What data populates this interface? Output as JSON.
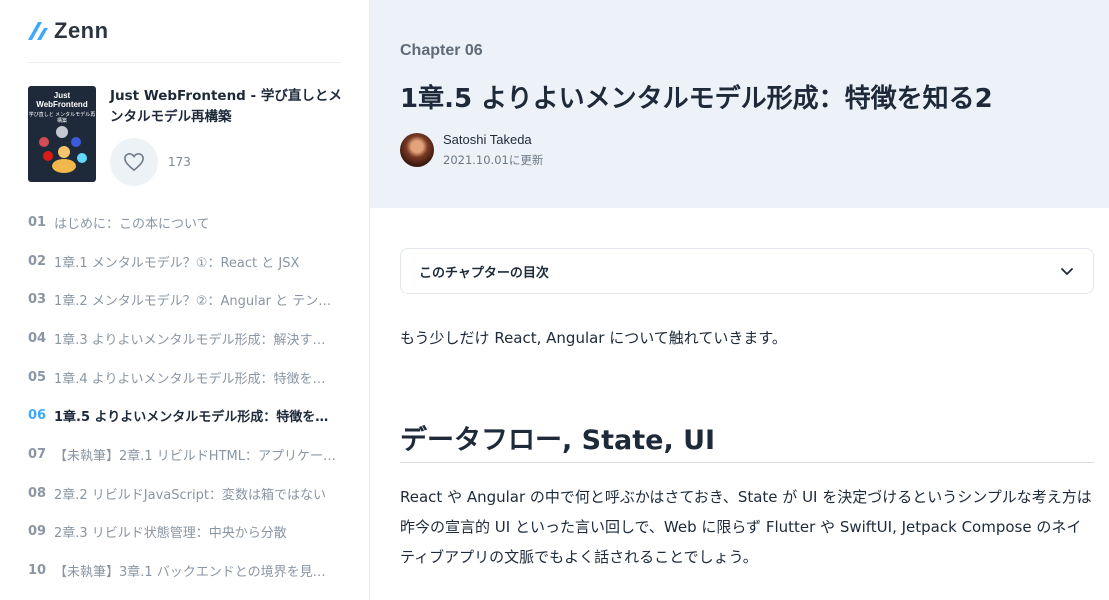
{
  "app": {
    "logo_text": "Zenn"
  },
  "book": {
    "cover_title": "Just WebFrontend",
    "cover_subtitle": "学び直しと メンタルモデル再構築",
    "title": "Just WebFrontend - 学び直しとメンタルモデル再構築",
    "like_count": "173"
  },
  "chapters": [
    {
      "num": "01",
      "label": "はじめに：この本について"
    },
    {
      "num": "02",
      "label": "1章.1 メンタルモデル？①：React と JSX"
    },
    {
      "num": "03",
      "label": "1章.2 メンタルモデル？②：Angular と テン…"
    },
    {
      "num": "04",
      "label": "1章.3 よりよいメンタルモデル形成：解決す…"
    },
    {
      "num": "05",
      "label": "1章.4 よりよいメンタルモデル形成：特徴を…"
    },
    {
      "num": "06",
      "label": "1章.5 よりよいメンタルモデル形成：特徴を…"
    },
    {
      "num": "07",
      "label": "【未執筆】2章.1 リビルドHTML：アプリケー…"
    },
    {
      "num": "08",
      "label": "2章.2 リビルドJavaScript：変数は箱ではない"
    },
    {
      "num": "09",
      "label": "2章.3 リビルド状態管理：中央から分散"
    },
    {
      "num": "10",
      "label": "【未執筆】3章.1 バックエンドとの境界を見…"
    }
  ],
  "header": {
    "chapter_tag": "Chapter 06",
    "title": "1章.5 よりよいメンタルモデル形成：特徴を知る2",
    "author": "Satoshi Takeda",
    "updated": "2021.10.01に更新"
  },
  "toc": {
    "label": "このチャプターの目次"
  },
  "content": {
    "intro": "もう少しだけ React, Angular について触れていきます。",
    "section_heading": "データフロー, State, UI",
    "paragraph": "React や Angular の中で何と呼ぶかはさておき、State が UI を決定づけるというシンプルな考え方は昨今の宣言的 UI といった言い回しで、Web に限らず Flutter や SwiftUI, Jetpack Compose のネイティブアプリの文脈でもよく話されることでしょう。"
  },
  "colors": {
    "accent": "#3ea8ff",
    "header_bg": "#edf2f8"
  }
}
